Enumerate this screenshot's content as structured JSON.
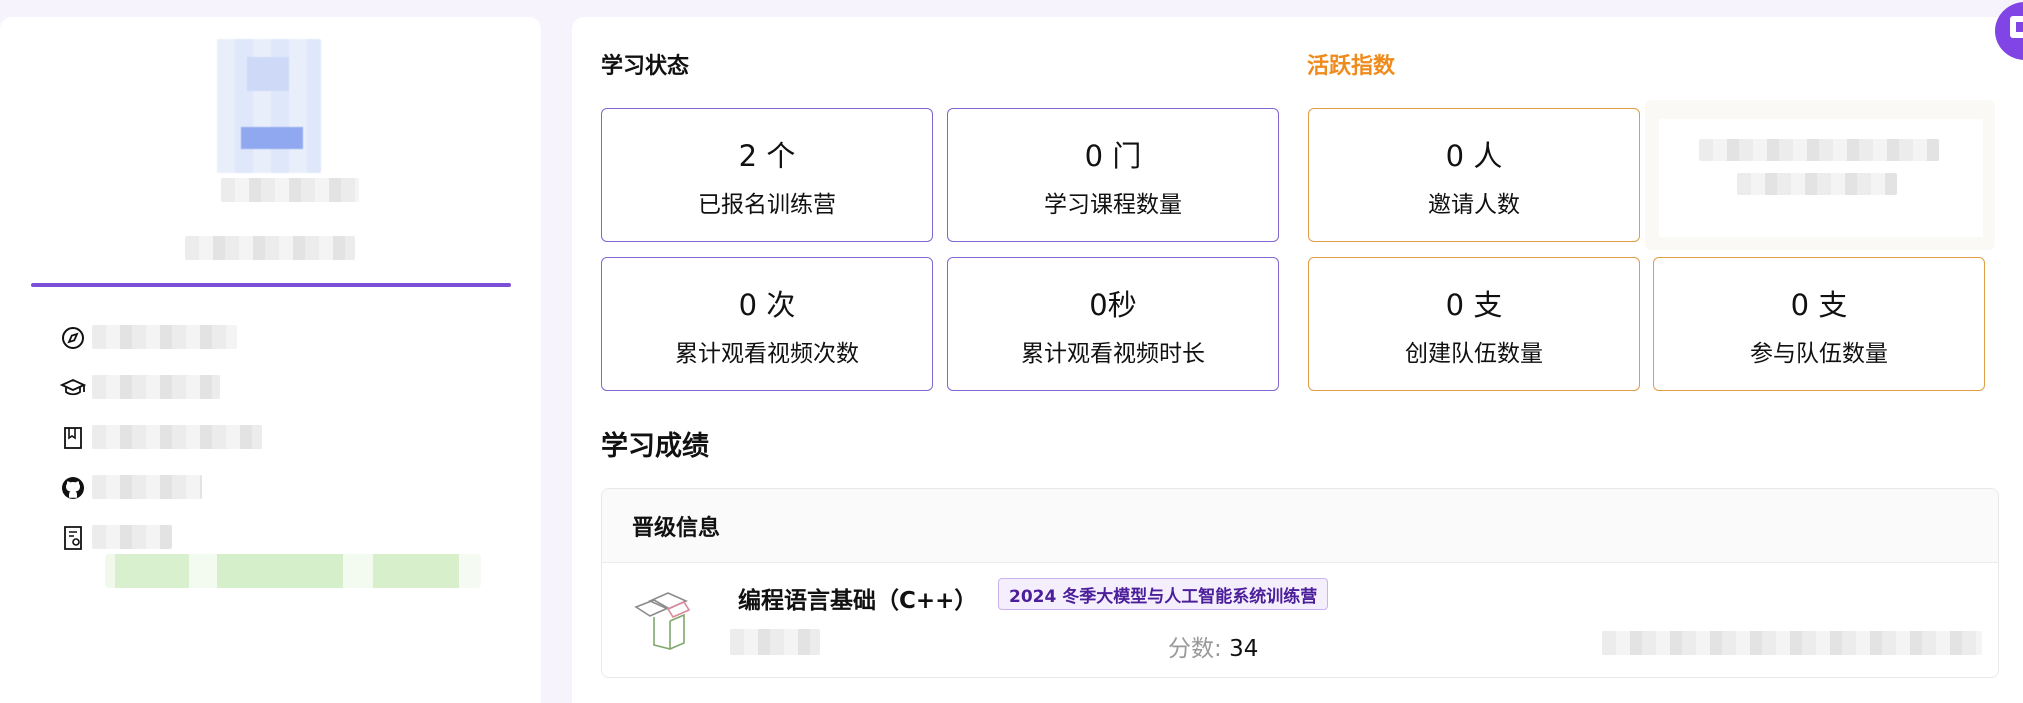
{
  "study_status": {
    "title": "学习状态",
    "cards": [
      {
        "value": "2 个",
        "label": "已报名训练营"
      },
      {
        "value": "0 门",
        "label": "学习课程数量"
      },
      {
        "value": "0 次",
        "label": "累计观看视频次数"
      },
      {
        "value": "0秒",
        "label": "累计观看视频时长"
      }
    ]
  },
  "activity_index": {
    "title": "活跃指数",
    "cards": [
      {
        "value": "0 人",
        "label": "邀请人数"
      },
      {
        "value": "0 支",
        "label": "创建队伍数量"
      },
      {
        "value": "0 支",
        "label": "参与队伍数量"
      }
    ]
  },
  "achievements": {
    "title": "学习成绩",
    "promotion_header": "晋级信息",
    "course": {
      "name": "编程语言基础（C++）",
      "camp_tag": "2024 冬季大模型与人工智能系统训练营",
      "score_label": "分数:",
      "score_value": "34"
    }
  },
  "profile_icons": [
    "compass-icon",
    "graduation-cap-icon",
    "book-icon",
    "github-icon",
    "certificate-icon"
  ],
  "colors": {
    "accent_purple": "#7b4fd8",
    "activity_orange": "#ef8b1c",
    "page_background": "#f6f3fd"
  }
}
